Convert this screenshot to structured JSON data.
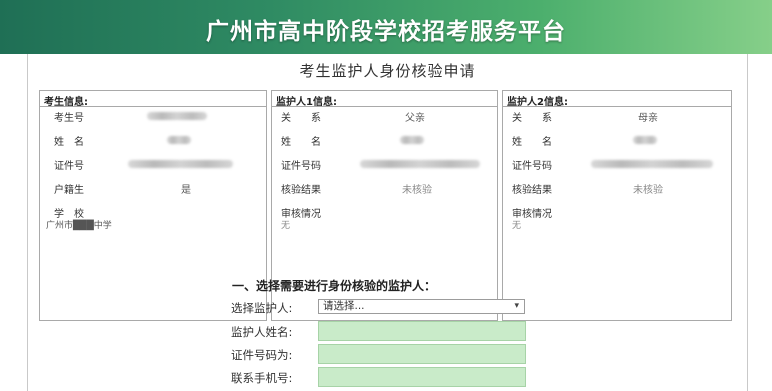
{
  "banner": {
    "title": "广州市高中阶段学校招考服务平台"
  },
  "page": {
    "title": "考生监护人身份核验申请"
  },
  "student": {
    "header": "考生信息:",
    "rows": [
      {
        "label": "考生号"
      },
      {
        "label": "姓　名"
      },
      {
        "label": "证件号"
      },
      {
        "label": "户籍生",
        "value": "是"
      },
      {
        "label": "学　校"
      }
    ],
    "school_value": "广州市███中学"
  },
  "guardian1": {
    "header": "监护人1信息:",
    "relation_label": "关　　系",
    "relation_value": "父亲",
    "name_label": "姓　　名",
    "id_label": "证件号码",
    "verify_label": "核验结果",
    "verify_value": "未核验",
    "review_label": "审核情况",
    "review_value": "无"
  },
  "guardian2": {
    "header": "监护人2信息:",
    "relation_label": "关　　系",
    "relation_value": "母亲",
    "name_label": "姓　　名",
    "id_label": "证件号码",
    "verify_label": "核验结果",
    "verify_value": "未核验",
    "review_label": "审核情况",
    "review_value": "无"
  },
  "form": {
    "section_title": "一、选择需要进行身份核验的监护人：",
    "select_label": "选择监护人:",
    "select_value": "请选择...",
    "name_label": "监护人姓名:",
    "id_label": "证件号码为:",
    "phone_label": "联系手机号:"
  }
}
